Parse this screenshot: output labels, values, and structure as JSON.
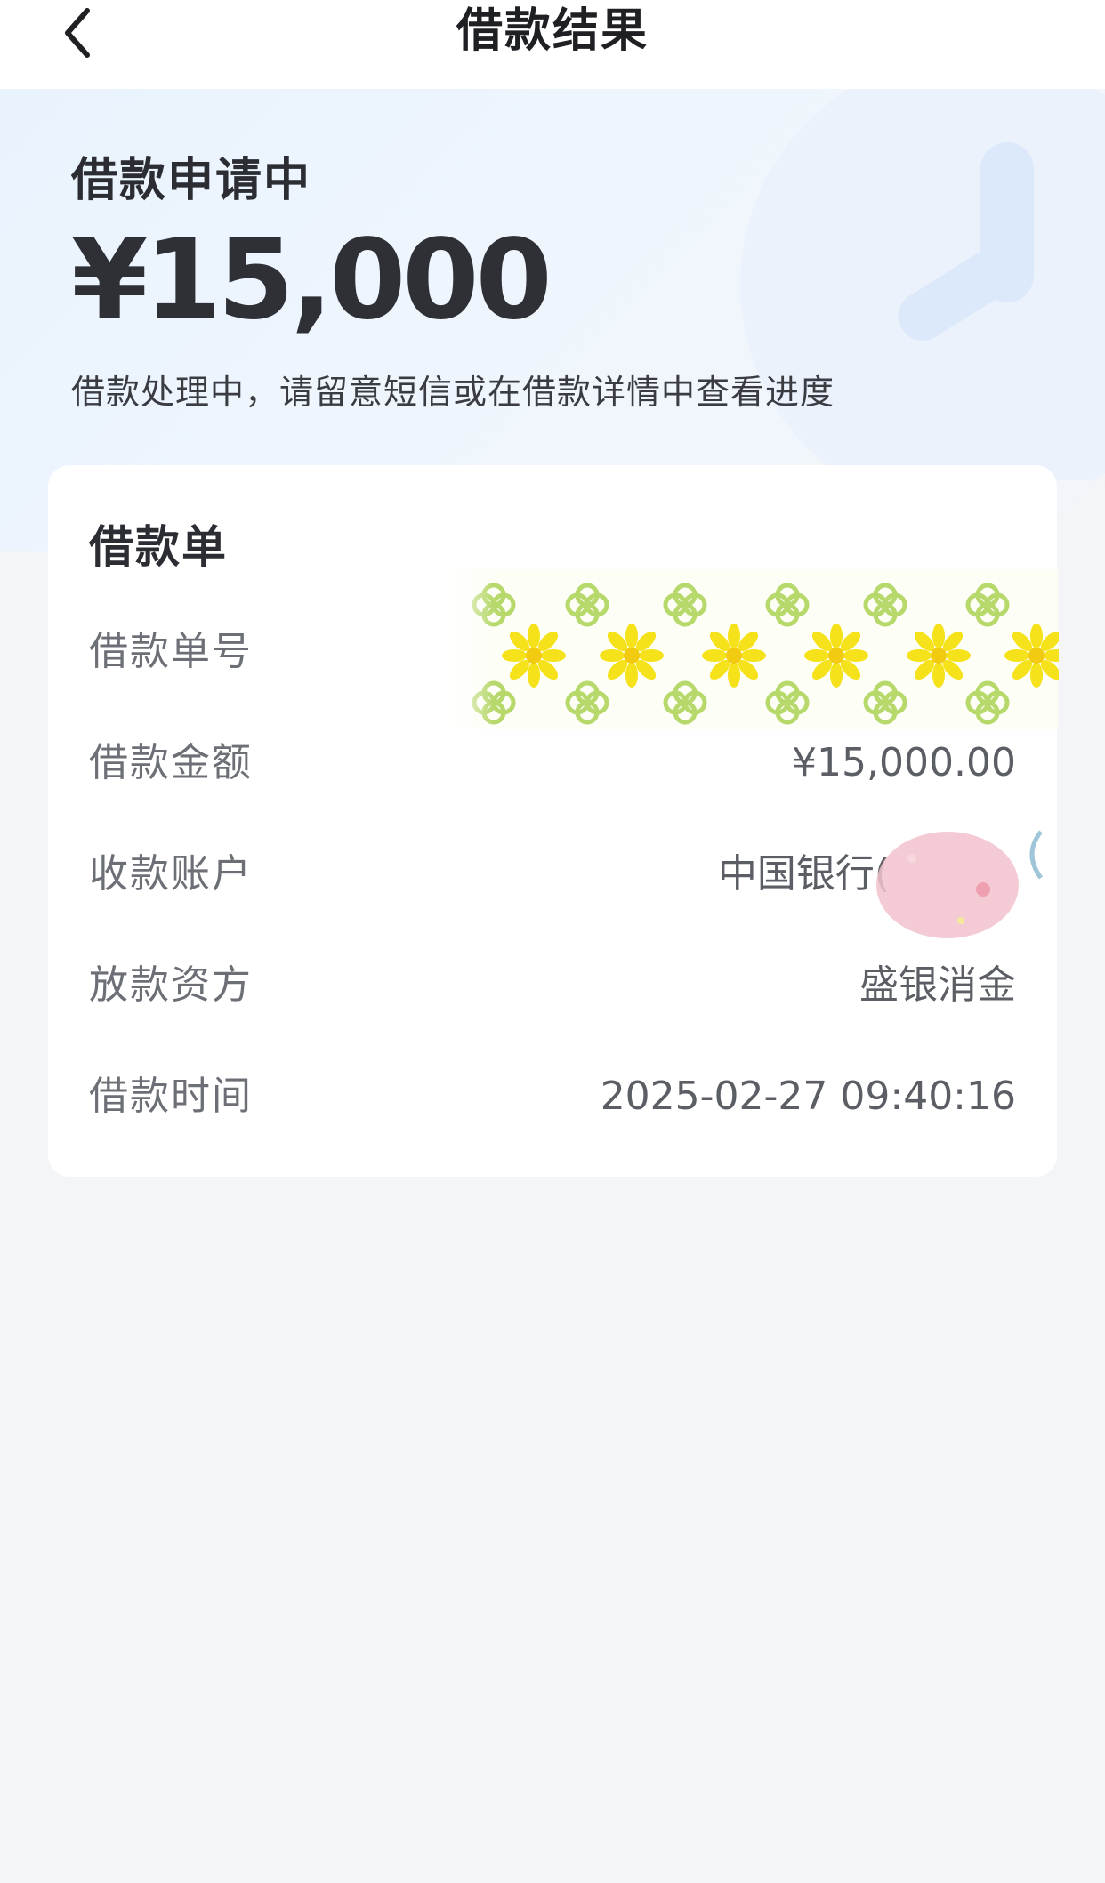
{
  "header": {
    "title": "借款结果",
    "back_icon": "chevron-left-icon"
  },
  "status": {
    "title": "借款申请中",
    "amount": "¥15,000",
    "hint": "借款处理中，请留意短信或在借款详情中查看进度"
  },
  "loan_card": {
    "title": "借款单",
    "rows": [
      {
        "label": "借款单号",
        "value": ""
      },
      {
        "label": "借款金额",
        "value": "¥15,000.00"
      },
      {
        "label": "收款账户",
        "value": "中国银行("
      },
      {
        "label": "放款资方",
        "value": "盛银消金"
      },
      {
        "label": "借款时间",
        "value": "2025-02-27 09:40:16"
      }
    ]
  },
  "colors": {
    "page_bg": "#f3f5f8",
    "hero_gradient_start": "#e9f3fd",
    "text_primary": "#2b2d33",
    "text_secondary": "#6c6f76",
    "sticker_yellow": "#f5e21b",
    "sticker_green": "#b7d86a",
    "sticker_pink": "#f2c2cc"
  }
}
